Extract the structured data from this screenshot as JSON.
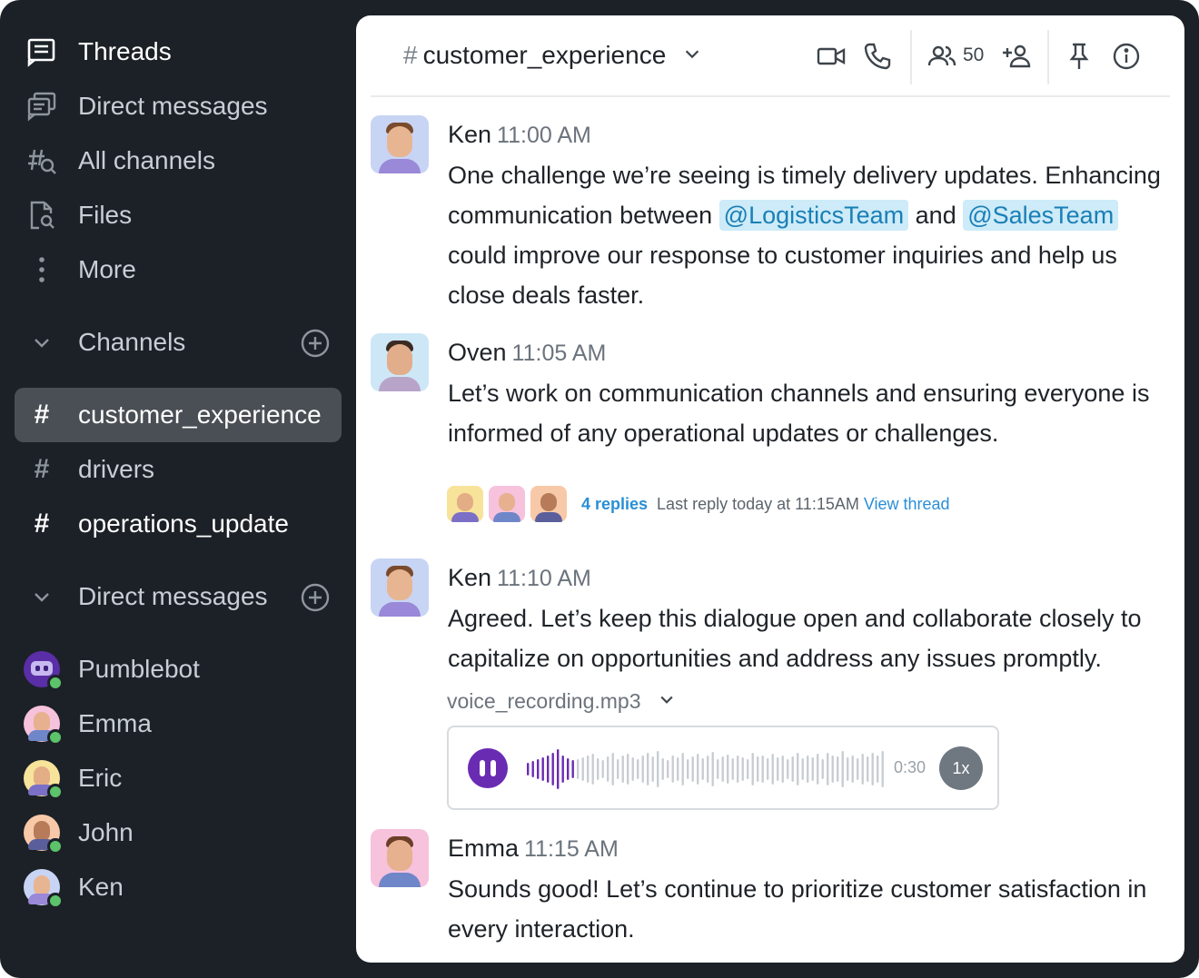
{
  "sidebar": {
    "nav": [
      {
        "label": "Threads",
        "icon": "threads-icon"
      },
      {
        "label": "Direct messages",
        "icon": "direct-messages-icon"
      },
      {
        "label": "All channels",
        "icon": "search-channels-icon"
      },
      {
        "label": "Files",
        "icon": "files-icon"
      },
      {
        "label": "More",
        "icon": "more-vertical-icon"
      }
    ],
    "channels_header": "Channels",
    "channels": [
      {
        "name": "customer_experience",
        "selected": true
      },
      {
        "name": "drivers",
        "selected": false
      },
      {
        "name": "operations_update",
        "selected": false
      }
    ],
    "dm_header": "Direct messages",
    "dms": [
      {
        "name": "Pumblebot"
      },
      {
        "name": "Emma"
      },
      {
        "name": "Eric"
      },
      {
        "name": "John"
      },
      {
        "name": "Ken"
      }
    ]
  },
  "header": {
    "channel_name": "customer_experience",
    "hash": "#",
    "member_count": "50"
  },
  "messages": [
    {
      "author": "Ken",
      "time": "11:00 AM",
      "text_1": "One challenge we’re seeing is timely delivery updates. Enhancing communication between ",
      "mention_1": "@LogisticsTeam",
      "text_2": " and ",
      "mention_2": "@SalesTeam",
      "text_3": " could improve our response to customer inquiries and help us close deals faster."
    },
    {
      "author": "Oven",
      "time": "11:05 AM",
      "text": "Let’s work on communication channels and ensuring everyone is informed of any operational updates or challenges.",
      "thread": {
        "replies": "4 replies",
        "last_reply": "Last reply today at 11:15AM",
        "view": "View thread"
      }
    },
    {
      "author": "Ken",
      "time": "11:10 AM",
      "text": "Agreed. Let’s keep this dialogue open and collaborate closely to capitalize on opportunities and address any issues promptly.",
      "attachment": {
        "file_name": "voice_recording.mp3",
        "duration": "0:30",
        "speed": "1x",
        "played_fraction": 0.13
      }
    },
    {
      "author": "Emma",
      "time": "11:15 AM",
      "text": "Sounds good! Let’s continue to prioritize customer satisfaction in every interaction."
    }
  ],
  "colors": {
    "sidebar_bg": "#1c2127",
    "selected_bg": "#4a4f55",
    "accent_purple": "#6a2bb3",
    "link_blue": "#2a8fd6",
    "mention_bg": "#cdebf8",
    "online_green": "#5cc36a"
  }
}
